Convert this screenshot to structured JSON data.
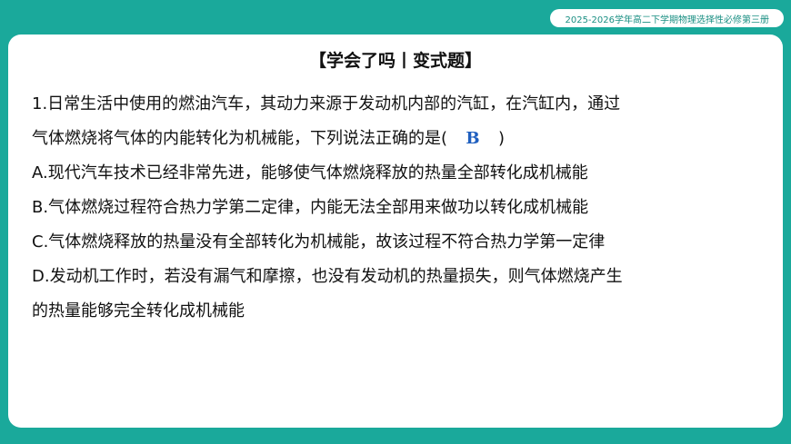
{
  "header": {
    "badge_text": "2025-2026学年高二下学期物理选择性必修第三册"
  },
  "section": {
    "title": "【学会了吗丨变式题】"
  },
  "question": {
    "stem_line1": "1.日常生活中使用的燃油汽车，其动力来源于发动机内部的汽缸，在汽缸内，通过",
    "stem_line2_prefix": "气体燃烧将气体的内能转化为机械能，下列说法正确的是(",
    "answer": "B",
    "stem_line2_suffix": ")",
    "options": [
      "A.现代汽车技术已经非常先进，能够使气体燃烧释放的热量全部转化成机械能",
      "B.气体燃烧过程符合热力学第二定律，内能无法全部用来做功以转化成机械能",
      "C.气体燃烧释放的热量没有全部转化为机械能，故该过程不符合热力学第一定律"
    ],
    "option_d_line1": "D.发动机工作时，若没有漏气和摩擦，也没有发动机的热量损失，则气体燃烧产生",
    "option_d_line2": "的热量能够完全转化成机械能"
  },
  "colors": {
    "background": "#1aa99b",
    "answer": "#1f5fbf"
  }
}
